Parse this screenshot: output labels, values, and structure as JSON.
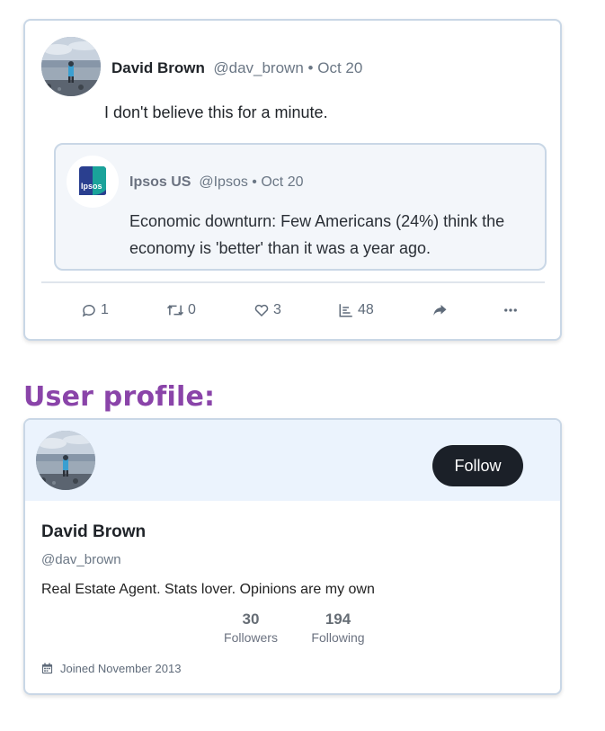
{
  "tweet": {
    "author_name": "David Brown",
    "author_handle": "@dav_brown",
    "separator": "•",
    "date": "Oct 20",
    "text": "I don't believe this for a minute.",
    "quoted": {
      "author_name": "Ipsos US",
      "author_handle": "@Ipsos",
      "separator": "•",
      "date": "Oct 20",
      "logo_text": "Ipsos",
      "text": "Economic downturn: Few Americans (24%) think the economy is 'better' than it was a year ago."
    },
    "actions": {
      "replies": "1",
      "retweets": "0",
      "likes": "3",
      "views": "48"
    },
    "icons": [
      "comment-icon",
      "retweet-icon",
      "heart-icon",
      "stats-icon",
      "share-icon",
      "more-icon"
    ]
  },
  "section": {
    "title": "User profile:"
  },
  "profile": {
    "name": "David Brown",
    "handle": "@dav_brown",
    "bio": "Real Estate Agent. Stats lover. Opinions are my own",
    "follow_label": "Follow",
    "followers_count": "30",
    "followers_label": "Followers",
    "following_count": "194",
    "following_label": "Following",
    "joined": "Joined November 2013"
  },
  "colors": {
    "accent_purple": "#8a44a9",
    "follow_button": "#1b2028",
    "banner": "#ebf3fd",
    "ipsos_teal": "#1aa39a",
    "ipsos_navy": "#2a3f8f"
  }
}
